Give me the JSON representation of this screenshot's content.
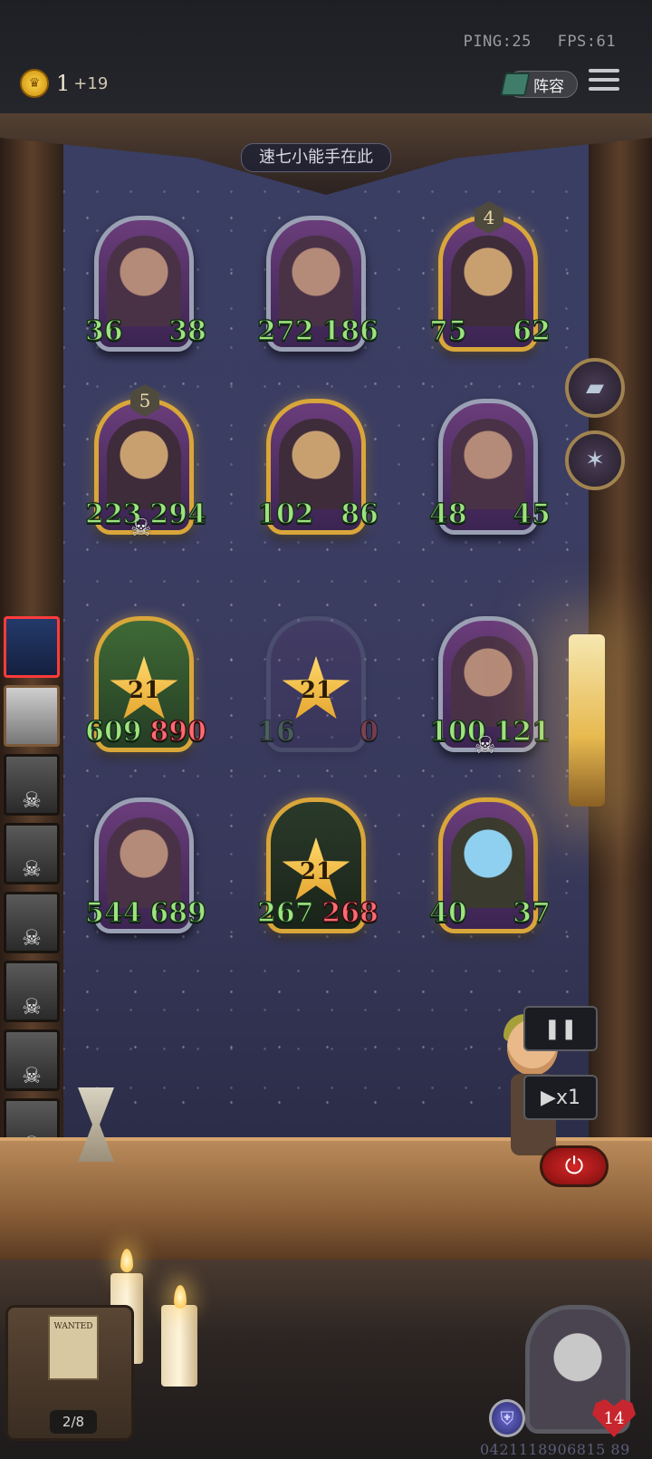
{
  "status": {
    "ping": "PING:25",
    "fps": "FPS:61"
  },
  "currency": {
    "count": "1",
    "bonus": "+19"
  },
  "lineup_button": {
    "label": "阵容"
  },
  "banner": "速七小能手在此",
  "board": {
    "row1": [
      {
        "atk": "36",
        "hp": "38"
      },
      {
        "atk": "272",
        "hp": "186"
      },
      {
        "atk": "75",
        "hp": "62",
        "level": "4"
      }
    ],
    "row2": [
      {
        "atk": "223",
        "hp": "294",
        "level": "5"
      },
      {
        "atk": "102",
        "hp": "86"
      },
      {
        "atk": "48",
        "hp": "45"
      }
    ],
    "row3": [
      {
        "atk": "609",
        "hp": "890",
        "star": "21"
      },
      {
        "atk": "16",
        "hp": "0",
        "star": "21"
      },
      {
        "atk": "100",
        "hp": "121"
      }
    ],
    "row4": [
      {
        "atk": "544",
        "hp": "689"
      },
      {
        "atk": "267",
        "hp": "268",
        "star": "21"
      },
      {
        "atk": "40",
        "hp": "37"
      }
    ]
  },
  "speed": "▶x1",
  "wanted": {
    "poster": "WANTED",
    "progress": "2/8"
  },
  "player": {
    "health": "14",
    "uid": "0421118906815 89"
  },
  "colors": {
    "stat_green": "#9de37e",
    "stat_red": "#ff6b72",
    "gold_frame": "#d9a63a",
    "power": "#d52626"
  }
}
